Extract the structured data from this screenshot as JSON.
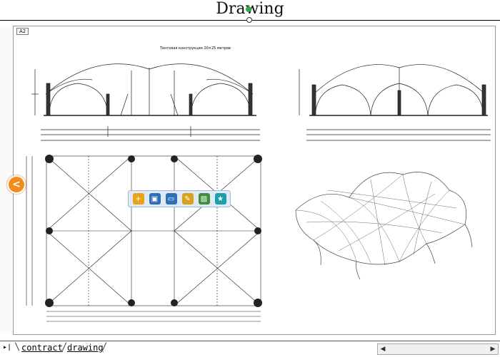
{
  "document": {
    "title": "Drawing",
    "sheet_tag": "A2",
    "drawing_caption": "Тентовая конструкция 20×25 метров"
  },
  "toolbar": {
    "buttons": [
      {
        "icon": "add-icon",
        "color": "#e8a317"
      },
      {
        "icon": "save-icon",
        "color": "#2e6fb8"
      },
      {
        "icon": "monitor-icon",
        "color": "#2e6fb8"
      },
      {
        "icon": "paint-icon",
        "color": "#d9a21a"
      },
      {
        "icon": "image-icon",
        "color": "#3f8f3a"
      },
      {
        "icon": "bookmark-icon",
        "color": "#1aa0a8"
      }
    ]
  },
  "nav": {
    "prev_label": "<"
  },
  "sheet_tabs": {
    "nav_label": "▸|",
    "tabs": [
      {
        "label": "contract"
      },
      {
        "label": "drawing"
      }
    ]
  },
  "scrollbar": {
    "left_arrow": "◀",
    "right_arrow": "▶"
  },
  "colors": {
    "accent_orange": "#f28a1e",
    "toolbar_bg": "#dfeaf5",
    "line": "#000000"
  }
}
